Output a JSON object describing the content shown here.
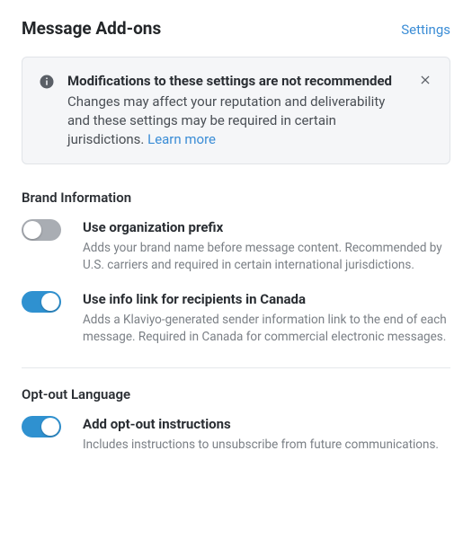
{
  "header": {
    "title": "Message Add-ons",
    "settings_link": "Settings"
  },
  "banner": {
    "title": "Modifications to these settings are not recommended",
    "body": "Changes may affect your reputation and deliverability and these settings may be required in certain jurisdictions. ",
    "link_label": "Learn more"
  },
  "sections": {
    "brand": {
      "heading": "Brand Information",
      "items": [
        {
          "title": "Use organization prefix",
          "desc": "Adds your brand name before message content. Recommended by U.S. carriers and required in certain international jurisdictions.",
          "on": false
        },
        {
          "title": "Use info link for recipients in Canada",
          "desc": "Adds a Klaviyo-generated sender information link to the end of each message. Required in Canada for commercial electronic messages.",
          "on": true
        }
      ]
    },
    "optout": {
      "heading": "Opt-out Language",
      "items": [
        {
          "title": "Add opt-out instructions",
          "desc": "Includes instructions to unsubscribe from future communications.",
          "on": true
        }
      ]
    }
  }
}
